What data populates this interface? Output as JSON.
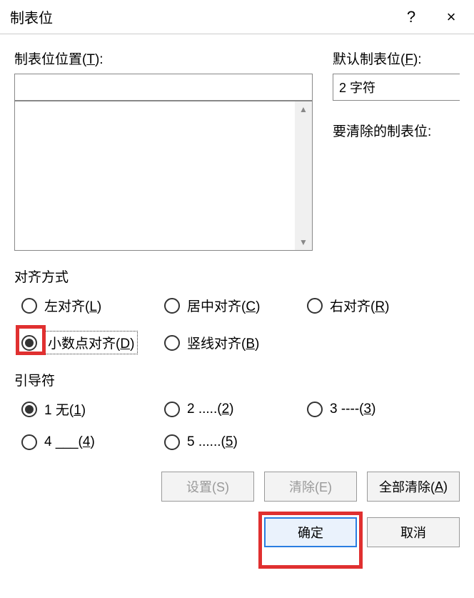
{
  "titlebar": {
    "title": "制表位",
    "help": "?",
    "close": "×"
  },
  "position": {
    "label_pre": "制表位位置(",
    "label_key": "T",
    "label_post": "):",
    "value": ""
  },
  "defaultTab": {
    "label_pre": "默认制表位(",
    "label_key": "F",
    "label_post": "):",
    "value": "2 字符"
  },
  "clearLabel": "要清除的制表位:",
  "alignment": {
    "title": "对齐方式",
    "options": [
      {
        "label_pre": "左对齐(",
        "label_key": "L",
        "label_post": ")",
        "checked": false
      },
      {
        "label_pre": "居中对齐(",
        "label_key": "C",
        "label_post": ")",
        "checked": false
      },
      {
        "label_pre": "右对齐(",
        "label_key": "R",
        "label_post": ")",
        "checked": false
      },
      {
        "label_pre": "小数点对齐(",
        "label_key": "D",
        "label_post": ")",
        "checked": true,
        "focused": true,
        "highlighted": true
      },
      {
        "label_pre": "竖线对齐(",
        "label_key": "B",
        "label_post": ")",
        "checked": false
      }
    ]
  },
  "leader": {
    "title": "引导符",
    "options": [
      {
        "label_pre": "1 无(",
        "label_key": "1",
        "label_post": ")",
        "checked": true
      },
      {
        "label_pre": "2 .....(",
        "label_key": "2",
        "label_post": ")",
        "checked": false
      },
      {
        "label_pre": "3 ----(",
        "label_key": "3",
        "label_post": ")",
        "checked": false
      },
      {
        "label_pre": "4 ___(",
        "label_key": "4",
        "label_post": ")",
        "checked": false
      },
      {
        "label_pre": "5 ......(",
        "label_key": "5",
        "label_post": ")",
        "checked": false
      }
    ]
  },
  "buttons": {
    "set": "设置(S)",
    "clear": "清除(E)",
    "clearAll_pre": "全部清除(",
    "clearAll_key": "A",
    "clearAll_post": ")",
    "ok": "确定",
    "cancel": "取消"
  }
}
